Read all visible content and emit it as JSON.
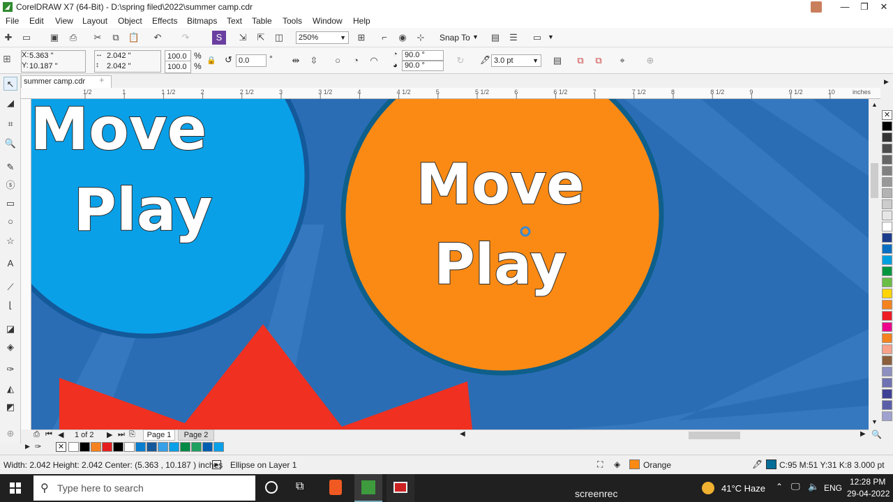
{
  "window": {
    "title": "CorelDRAW X7 (64-Bit) - D:\\spring filed\\2022\\summer camp.cdr"
  },
  "menu": [
    "File",
    "Edit",
    "View",
    "Layout",
    "Object",
    "Effects",
    "Bitmaps",
    "Text",
    "Table",
    "Tools",
    "Window",
    "Help"
  ],
  "toolbar": {
    "zoom": "250%",
    "snap_to": "Snap To"
  },
  "properties": {
    "x": "5.363 \"",
    "y": "10.187 \"",
    "w": "2.042 \"",
    "h": "2.042 \"",
    "scale_w": "100.0",
    "scale_h": "100.0",
    "pct": "%",
    "angle": "0.0",
    "deg": "°",
    "arc_start": "90.0 °",
    "arc_end": "90.0 °",
    "outline": "3.0 pt"
  },
  "doc_tab": "summer camp.cdr",
  "ruler": {
    "labels": [
      "1/2",
      "1",
      "1 1/2",
      "2",
      "2 1/2",
      "3",
      "3 1/2",
      "4",
      "4 1/2",
      "5",
      "5 1/2",
      "6",
      "6 1/2",
      "7",
      "7 1/2",
      "8",
      "8 1/2",
      "9",
      "9 1/2",
      "10"
    ],
    "unit": "inches"
  },
  "canvas": {
    "left_circle": {
      "line1": "Move",
      "line2": "Play"
    },
    "right_circle": {
      "line1": "Move",
      "line2": "Play"
    },
    "colors": {
      "background": "#2a6db5",
      "blue_circle": "#0aa0e8",
      "orange_circle": "#fb8a14",
      "outline": "#14599a",
      "red": "#f03020"
    }
  },
  "pages": {
    "counter": "1 of 2",
    "tabs": [
      "Page 1",
      "Page 2"
    ]
  },
  "palette_colors": [
    "#ffffff",
    "#000000",
    "#333333",
    "#4d4d4d",
    "#666666",
    "#808080",
    "#999999",
    "#b3b3b3",
    "#cccccc",
    "#e6e6e6",
    "#ffffff",
    "#1b3c8c",
    "#0a6fc2",
    "#00a0e0",
    "#00963f",
    "#6abe45",
    "#ffd400",
    "#f5821f",
    "#ee1c25",
    "#ec008c",
    "#f5821f",
    "#f9a18b",
    "#8b5e3c",
    "#8c8fbf",
    "#6f72b2",
    "#3e4095",
    "#5a5ea8",
    "#9fa2cf"
  ],
  "doc_palette_colors": [
    "#ffffff",
    "#000000",
    "#f5821f",
    "#e51f1f",
    "#000000",
    "#ffffff",
    "#0a7fd0",
    "#16599a",
    "#36a0e8",
    "#0aa0e8",
    "#008a45",
    "#1fa060",
    "#005eb0",
    "#0aa0e8"
  ],
  "status": {
    "size": "Width: 2.042  Height: 2.042  Center: (5.363 , 10.187 )  inches",
    "object": "Ellipse on Layer 1",
    "fill_name": "Orange",
    "fill_color": "#fb8a14",
    "outline_info": "C:95 M:51 Y:31 K:8  3.000 pt",
    "outline_color": "#066e99"
  },
  "taskbar": {
    "search_placeholder": "Type here to search",
    "weather": "41°C  Haze",
    "lang": "ENG",
    "time": "12:28 PM",
    "date": "29-04-2022",
    "watermark": "screenrec"
  }
}
